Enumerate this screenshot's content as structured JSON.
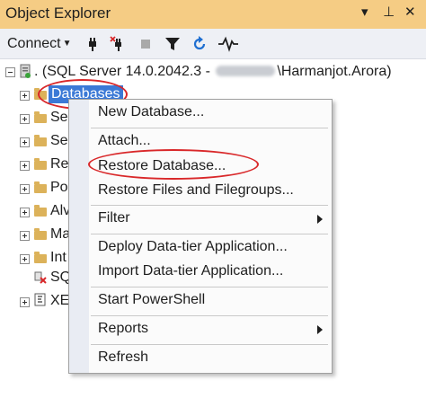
{
  "window": {
    "title": "Object Explorer",
    "controls": {
      "dropdown": "▾",
      "pin": "⊥",
      "close": "✕"
    }
  },
  "toolbar": {
    "connect_label": "Connect",
    "icons": [
      "connect-plug-icon",
      "disconnect-plug-icon",
      "stop-icon",
      "filter-icon",
      "refresh-icon",
      "activity-monitor-icon"
    ]
  },
  "tree": {
    "server": {
      "prefix": ". (SQL Server 14.0.2042.3 - ",
      "suffix": "\\Harmanjot.Arora)"
    },
    "nodes": [
      {
        "label": "Databases",
        "selected": true
      },
      {
        "label": "Se"
      },
      {
        "label": "Se"
      },
      {
        "label": "Re"
      },
      {
        "label": "Po"
      },
      {
        "label": "Alv"
      },
      {
        "label": "Ma"
      },
      {
        "label": "Int"
      },
      {
        "label": "SQ"
      },
      {
        "label": "XE"
      }
    ]
  },
  "context_menu": {
    "items": [
      {
        "label": "New Database..."
      },
      {
        "label": "Attach..."
      },
      {
        "label": "Restore Database...",
        "highlighted": true
      },
      {
        "label": "Restore Files and Filegroups..."
      },
      {
        "label": "Filter",
        "submenu": true
      },
      {
        "label": "Deploy Data-tier Application..."
      },
      {
        "label": "Import Data-tier Application..."
      },
      {
        "label": "Start PowerShell"
      },
      {
        "label": "Reports",
        "submenu": true
      },
      {
        "label": "Refresh"
      }
    ]
  },
  "colors": {
    "title_bar": "#f5cc84",
    "selection": "#3b79d6",
    "annotation": "#d9282a"
  }
}
